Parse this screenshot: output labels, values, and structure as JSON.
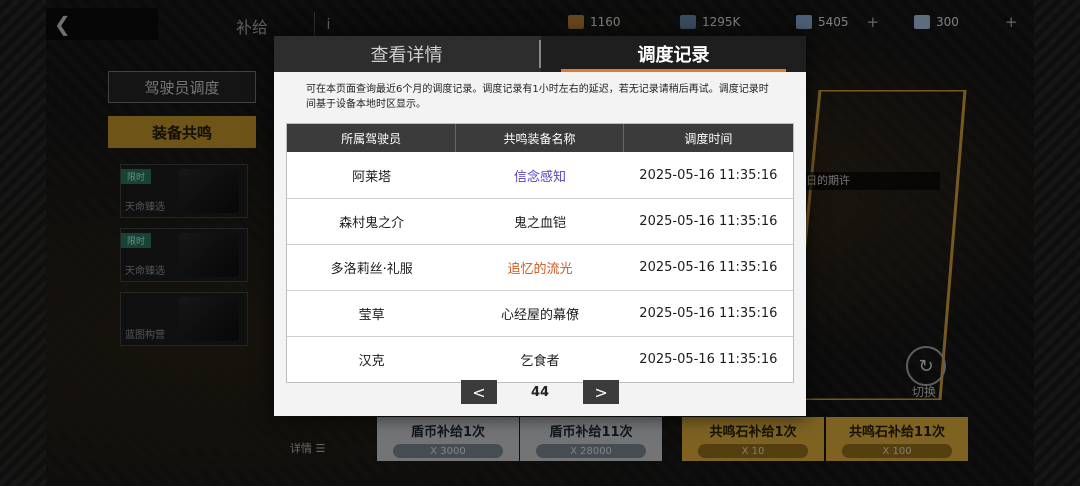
{
  "topbar": {
    "back_icon": "back-arrow-icon",
    "title": "补给",
    "info_label": "i",
    "resources": [
      {
        "icon": "crate-icon",
        "color": "#b8843a",
        "value": "1160",
        "plus": ""
      },
      {
        "icon": "chip-icon",
        "color": "#6b8fb0",
        "value": "1295K",
        "plus": ""
      },
      {
        "icon": "cube-icon",
        "color": "#8ab0d6",
        "value": "5405",
        "plus": "+"
      },
      {
        "icon": "crystal-icon",
        "color": "#a9c6e8",
        "value": "300",
        "plus": "+"
      }
    ]
  },
  "menu": {
    "pilot_dispatch": "驾驶员调度",
    "equip_resonance": "装备共鸣"
  },
  "cards": [
    {
      "tag": "限时",
      "caption": "天命臻选"
    },
    {
      "tag": "限时",
      "caption": "天命臻选"
    },
    {
      "tag": "",
      "caption": "蓝图构营"
    }
  ],
  "right_panel": {
    "label": "日的期许",
    "switch_label": "切换"
  },
  "bottom": {
    "detail_label": "详情 ☰",
    "supplies": [
      {
        "title": "盾币补给1次",
        "cost": "X 3000",
        "style": "silver"
      },
      {
        "title": "盾币补给11次",
        "cost": "X 28000",
        "style": "silver"
      },
      {
        "title": "共鸣石补给1次",
        "cost": "X 10",
        "style": "gold"
      },
      {
        "title": "共鸣石补给11次",
        "cost": "X 100",
        "style": "gold"
      }
    ]
  },
  "dialog": {
    "tabs": [
      {
        "label": "查看详情",
        "active": false
      },
      {
        "label": "调度记录",
        "active": true
      }
    ],
    "notice": "可在本页面查询最近6个月的调度记录。调度记录有1小时左右的延迟，若无记录请稍后再试。调度记录时间基于设备本地时区显示。",
    "columns": [
      "所属驾驶员",
      "共鸣装备名称",
      "调度时间"
    ],
    "rows": [
      {
        "pilot": "阿莱塔",
        "equipment": "信念感知",
        "time": "2025-05-16 11:35:16",
        "color": "#5b3fc7"
      },
      {
        "pilot": "森村鬼之介",
        "equipment": "鬼之血铠",
        "time": "2025-05-16 11:35:16",
        "color": "#1c1c1c"
      },
      {
        "pilot": "多洛莉丝·礼服",
        "equipment": "追忆的流光",
        "time": "2025-05-16 11:35:16",
        "color": "#d4561f"
      },
      {
        "pilot": "莹草",
        "equipment": "心经屋的幕僚",
        "time": "2025-05-16 11:35:16",
        "color": "#1c1c1c"
      },
      {
        "pilot": "汉克",
        "equipment": "乞食者",
        "time": "2025-05-16 11:35:16",
        "color": "#1c1c1c"
      }
    ],
    "pager": {
      "prev": "<",
      "page": "44",
      "next": ">"
    }
  }
}
